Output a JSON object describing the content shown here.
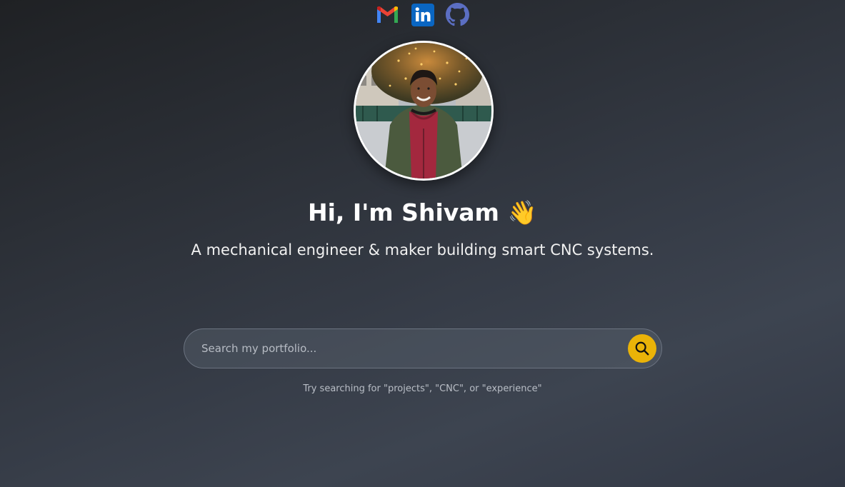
{
  "social": {
    "items": [
      {
        "name": "Gmail",
        "icon": "gmail-icon",
        "colors": [
          "#4285F4",
          "#EA4335",
          "#FBBC05",
          "#34A853"
        ]
      },
      {
        "name": "LinkedIn",
        "icon": "linkedin-icon",
        "color": "#0A66C2"
      },
      {
        "name": "GitHub",
        "icon": "github-icon",
        "color": "#5b6ec2"
      }
    ]
  },
  "profile": {
    "avatar_icon": "profile-photo",
    "border_color": "#ffffff"
  },
  "hero": {
    "title": "Hi, I'm Shivam",
    "emoji": "👋",
    "subtitle": "A mechanical engineer & maker building smart CNC systems."
  },
  "search": {
    "placeholder": "Search my portfolio...",
    "value": "",
    "button_icon": "search-icon",
    "button_color": "#eab308",
    "hint": "Try searching for \"projects\", \"CNC\", or \"experience\""
  }
}
